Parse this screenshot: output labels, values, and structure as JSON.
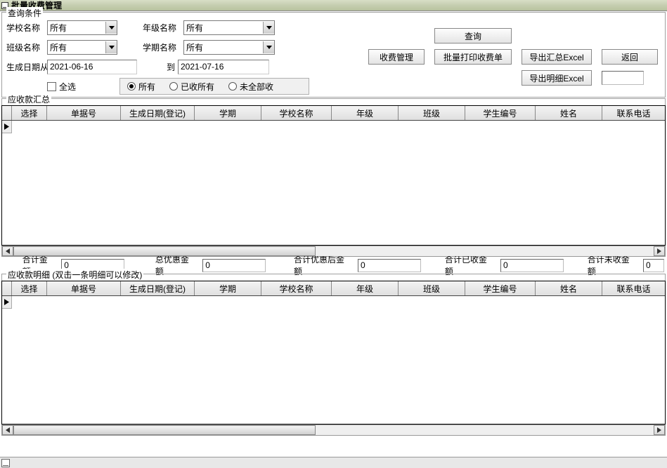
{
  "title": "批量收费管理",
  "queryGroup": {
    "legend": "查询条件",
    "schoolLabel": "学校名称",
    "schoolValue": "所有",
    "gradeLabel": "年级名称",
    "gradeValue": "所有",
    "classLabel": "班级名称",
    "classValue": "所有",
    "termLabel": "学期名称",
    "termValue": "所有",
    "dateFromLabel": "生成日期从",
    "dateFrom": "2021-06-16",
    "dateToLabel": "到",
    "dateTo": "2021-07-16",
    "selectAll": "全选",
    "radioAll": "所有",
    "radioReceived": "已收所有",
    "radioNotAll": "未全部收"
  },
  "buttons": {
    "query": "查询",
    "feeManage": "收费管理",
    "batchPrint": "批量打印收费单",
    "exportSummary": "导出汇总Excel",
    "back": "返回",
    "exportDetail": "导出明细Excel"
  },
  "summaryGroup": {
    "legend": "应收款汇总",
    "headers": {
      "select": "选择",
      "billNo": "单据号",
      "genDate": "生成日期(登记)",
      "term": "学期",
      "school": "学校名称",
      "grade": "年级",
      "class": "班级",
      "studentId": "学生编号",
      "name": "姓名",
      "phone": "联系电话"
    }
  },
  "totals": {
    "totalAmount": {
      "label": "合计金额",
      "value": "0"
    },
    "totalDiscount": {
      "label": "总优惠金额",
      "value": "0"
    },
    "afterDiscount": {
      "label": "合计优惠后金额",
      "value": "0"
    },
    "received": {
      "label": "合计已收金额",
      "value": "0"
    },
    "unreceived": {
      "label": "合计未收金额",
      "value": "0"
    }
  },
  "detailGroup": {
    "legend": "应收款明细 (双击一条明细可以修改)",
    "headers": {
      "select": "选择",
      "billNo": "单据号",
      "genDate": "生成日期(登记)",
      "term": "学期",
      "school": "学校名称",
      "grade": "年级",
      "class": "班级",
      "studentId": "学生编号",
      "name": "姓名",
      "phone": "联系电话"
    }
  }
}
